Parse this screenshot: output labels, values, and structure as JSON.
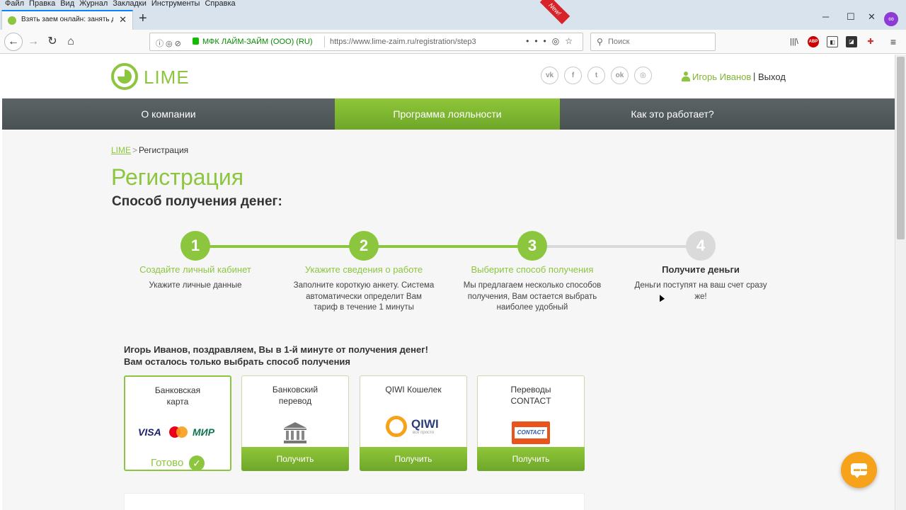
{
  "menubar": [
    "Файл",
    "Правка",
    "Вид",
    "Журнал",
    "Закладки",
    "Инструменты",
    "Справка"
  ],
  "browser": {
    "tab_title": "Взять заем онлайн: занять день",
    "site_identity": "МФК ЛАЙМ-ЗАЙМ (ООО) (RU)",
    "url": "https://www.lime-zaim.ru/registration/step3",
    "search_placeholder": "Поиск",
    "extension_badge": "∞"
  },
  "site": {
    "logo": "LIME",
    "social": [
      "vk",
      "fb",
      "tw",
      "ok",
      "ig"
    ],
    "user_name": "Игорь Иванов",
    "separator": "|",
    "logout": "Выход"
  },
  "mainnav": {
    "items": [
      "О компании",
      "Программа лояльности",
      "Как это работает?"
    ],
    "ribbon": "New!"
  },
  "breadcrumb": {
    "home": "LIME",
    "sep": ">",
    "current": "Регистрация"
  },
  "page": {
    "title": "Регистрация",
    "subtitle": "Способ получения денег:"
  },
  "steps": [
    {
      "num": "1",
      "title": "Создайте личный кабинет",
      "desc": "Укажите личные данные",
      "done": true
    },
    {
      "num": "2",
      "title": "Укажите сведения о работе",
      "desc": "Заполните короткую анкету. Система автоматически определит Вам тариф в течение 1 минуты",
      "done": true
    },
    {
      "num": "3",
      "title": "Выберите способ получения",
      "desc": "Мы предлагаем несколько способов получения, Вам остается выбрать наиболее удобный",
      "done": true
    },
    {
      "num": "4",
      "title": "Получите деньги",
      "desc": "Деньги поступят на ваш счет сразу же!",
      "done": false
    }
  ],
  "congrats": {
    "line1": "Игорь Иванов, поздравляем, Вы в 1-й минуте от получения денег!",
    "line2": "Вам осталось только выбрать способ получения"
  },
  "methods": [
    {
      "title_lines": [
        "Банковская",
        "карта"
      ],
      "status": "Готово",
      "logos": [
        "VISA",
        "МИР"
      ]
    },
    {
      "title_lines": [
        "Банковский",
        "перевод"
      ],
      "button": "Получить"
    },
    {
      "title_lines": [
        "QIWI Кошелек"
      ],
      "button": "Получить",
      "logo": "QIWI",
      "logo_sub": "всё просто"
    },
    {
      "title_lines": [
        "Переводы",
        "CONTACT"
      ],
      "button": "Получить",
      "logo": "CONTACT"
    }
  ],
  "colors": {
    "brand_green": "#8cc63f",
    "nav_dark": "#4f5658",
    "chat_orange": "#f7a21b",
    "ribbon_red": "#d8232a"
  }
}
